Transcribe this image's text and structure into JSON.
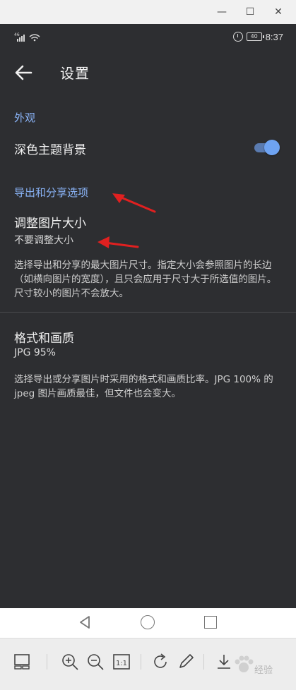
{
  "window": {
    "min_glyph": "—",
    "max_glyph": "☐",
    "close_glyph": "✕"
  },
  "status_bar": {
    "signal_label": "46",
    "battery": "40",
    "time": "8:37"
  },
  "appbar": {
    "title": "设置"
  },
  "sections": [
    {
      "header": "外观"
    },
    {
      "header": "导出和分享选项"
    }
  ],
  "appearance": {
    "dark_theme_label": "深色主题背景",
    "dark_theme_on": true
  },
  "resize": {
    "title": "调整图片大小",
    "value": "不要调整大小",
    "description": "选择导出和分享的最大图片尺寸。指定大小会参照图片的长边（如横向图片的宽度），且只会应用于尺寸大于所选值的图片。尺寸较小的图片不会放大。"
  },
  "format": {
    "title": "格式和画质",
    "value": "JPG 95%",
    "description": "选择导出或分享图片时采用的格式和画质比率。JPG 100% 的 jpeg 图片画质最佳，但文件也会变大。"
  },
  "toolbar": {
    "actual_size_label": "1:1"
  },
  "watermark": {
    "text": "经验"
  },
  "colors": {
    "accent": "#8ab4f8",
    "background": "#2d2e31",
    "annotation_arrow": "#e02020"
  }
}
